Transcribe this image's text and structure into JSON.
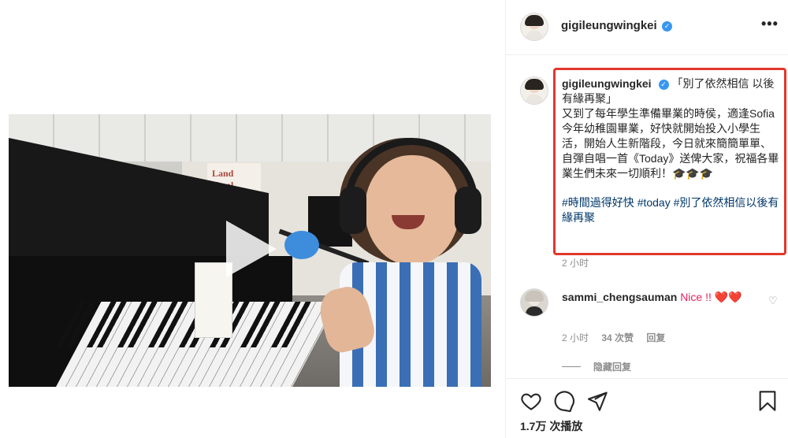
{
  "post": {
    "username": "gigileungwingkei",
    "more_label": "•••",
    "caption_lines": [
      "「別了依然相信 以後有緣再聚」",
      "又到了每年學生準備畢業的時侯，適逢Sofia今年幼稚園畢業，好快就開始投入小學生活，開始人生新階段，今日就來簡簡單單、自彈自唱一首《Today》送俾大家，祝福各畢業生們未來一切順利！🎓🎓🎓"
    ],
    "hashtags": [
      "#時間過得好快",
      "#today",
      "#別了依然相信以後有緣再聚"
    ],
    "time": "2 小时"
  },
  "comment": {
    "username": "sammi_chengsauman",
    "text": "Nice !! ❤️❤️",
    "time": "2 小时",
    "likes": "34 次赞",
    "reply": "回复",
    "hide_replies": "隐藏回复"
  },
  "stats": {
    "views": "1.7万 次播放"
  },
  "video": {
    "poster_text": "Land\nchool"
  },
  "icons": {
    "verified": "verified-badge-icon",
    "like": "heart-icon",
    "comment": "comment-bubble-icon",
    "share": "paper-plane-icon",
    "save": "bookmark-icon",
    "play": "play-icon"
  },
  "colors": {
    "highlight_border": "#e2372b",
    "link": "#00376b",
    "verified": "#3897f0",
    "muted": "#8e8e8e"
  }
}
